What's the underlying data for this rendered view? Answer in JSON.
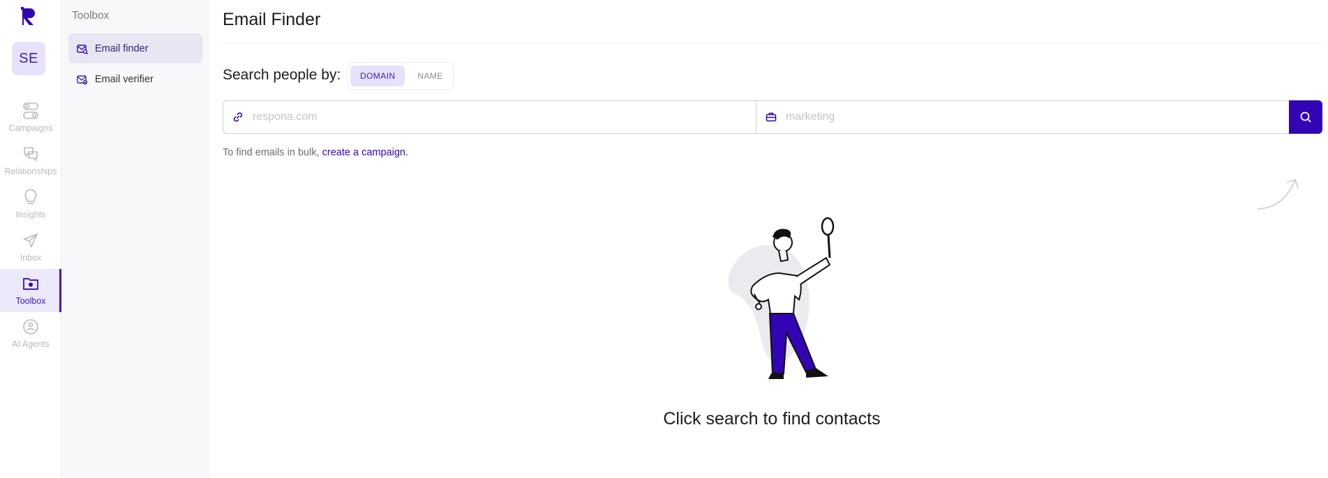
{
  "colors": {
    "accent": "#3204b3",
    "accent_light": "#e6e2fb",
    "muted": "#b9b9c3"
  },
  "rail": {
    "avatar": "SE",
    "items": [
      {
        "label": "Campaigns",
        "icon": "campaigns-icon"
      },
      {
        "label": "Relationships",
        "icon": "relationships-icon"
      },
      {
        "label": "Insights",
        "icon": "lightbulb-icon"
      },
      {
        "label": "Inbox",
        "icon": "paper-plane-icon"
      },
      {
        "label": "Toolbox",
        "icon": "folder-gear-icon",
        "active": true
      },
      {
        "label": "AI Agents",
        "icon": "ai-agent-icon"
      }
    ]
  },
  "subnav": {
    "title": "Toolbox",
    "items": [
      {
        "label": "Email finder",
        "icon": "email-search-icon",
        "active": true
      },
      {
        "label": "Email verifier",
        "icon": "email-check-icon"
      }
    ]
  },
  "main": {
    "title": "Email Finder",
    "search_by_label": "Search people by:",
    "toggle": {
      "domain": "DOMAIN",
      "name": "NAME",
      "selected": "DOMAIN"
    },
    "domain_field": {
      "placeholder": "respona.com",
      "value": ""
    },
    "keyword_field": {
      "placeholder": "marketing",
      "value": ""
    },
    "bulk_text": "To find emails in bulk,",
    "bulk_link": "create a campaign.",
    "empty_state": "Click search to find contacts"
  }
}
